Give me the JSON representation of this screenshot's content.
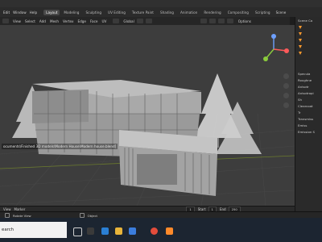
{
  "window": {
    "path_title": "ocuments\\Finished 3D models\\Modern House\\Modern house.blend]"
  },
  "menubar": {
    "items": [
      "Edit",
      "Window",
      "Help"
    ],
    "tabs": [
      "Layout",
      "Modeling",
      "Sculpting",
      "UV Editing",
      "Texture Paint",
      "Shading",
      "Animation",
      "Rendering",
      "Compositing",
      "Scripting"
    ],
    "active_tab": "Layout",
    "scene": "Scene"
  },
  "viewport_header": {
    "items": [
      "View",
      "Select",
      "Add",
      "Mesh",
      "Vertex",
      "Edge",
      "Face",
      "UV"
    ],
    "orientation": "Global",
    "options": "Options"
  },
  "timeline": {
    "menus": [
      "View",
      "Marker"
    ],
    "current_frame": "1",
    "start_label": "Start",
    "start_value": "1",
    "end_label": "End",
    "end_value": "250"
  },
  "status_bar": {
    "rotate_view": "Rotate View",
    "object_label": "Object"
  },
  "taskbar": {
    "search_text": "earch"
  },
  "properties": {
    "scene_collection": "Scene Co",
    "items": [
      "Specula",
      "Roughne",
      "Anisotr",
      "Anisotropi",
      "Sh",
      "Clearcoat",
      "Tr",
      "Transmiss",
      "Emiss",
      "Emission S"
    ]
  },
  "colors": {
    "accent": "#4772b3",
    "active_tab_bg": "#494949",
    "viewport_bg": "#3d3d3d",
    "taskbar_bg": "#1c2531",
    "outliner_orange": "#ff9a2e"
  }
}
